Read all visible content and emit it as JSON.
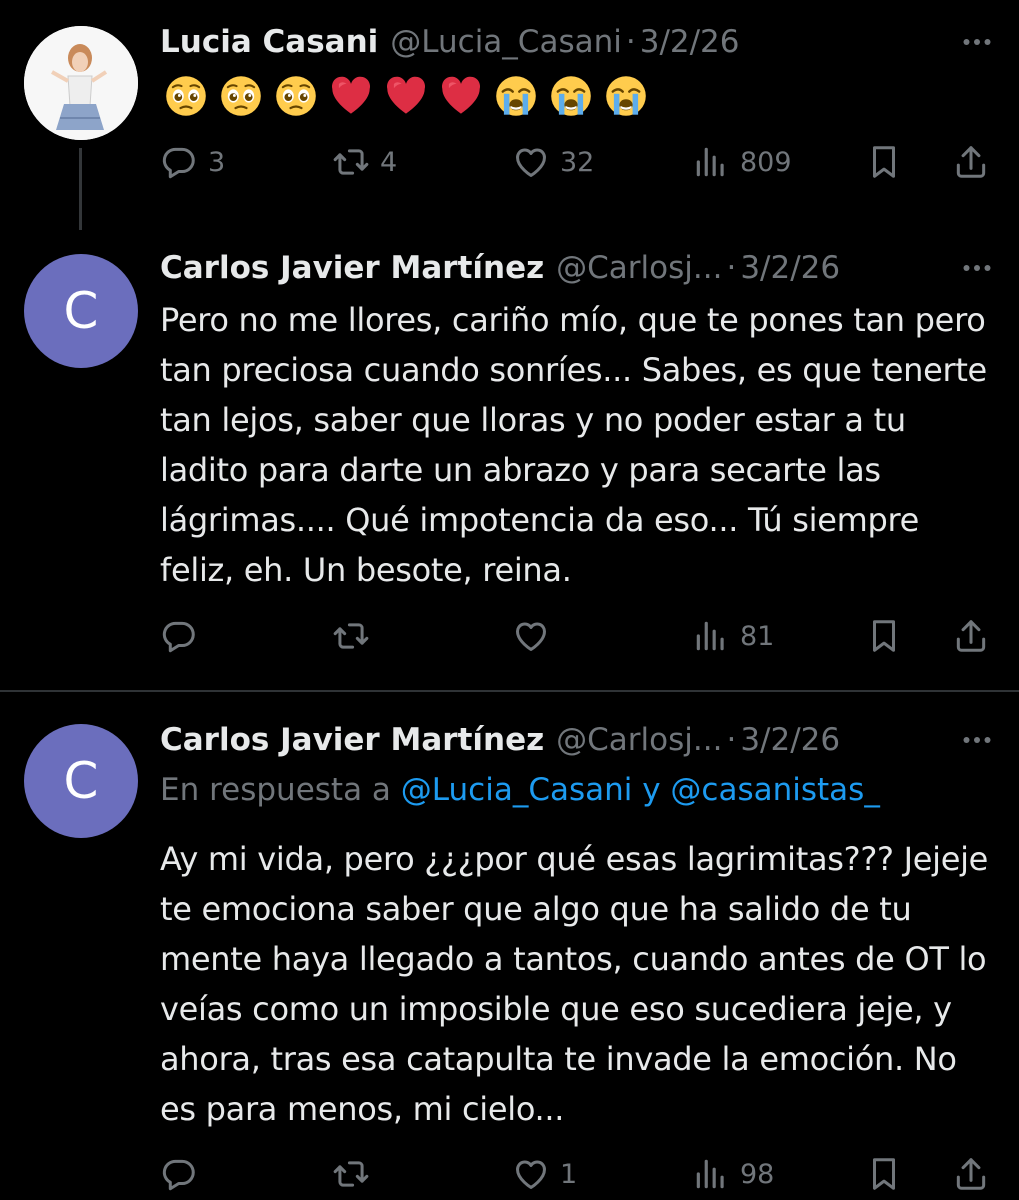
{
  "tweets": [
    {
      "name": "Lucia Casani",
      "handle": "@Lucia_Casani",
      "dot": "·",
      "date": "3/2/26",
      "text": "",
      "emojis": [
        "pleading-face",
        "pleading-face",
        "pleading-face",
        "red-heart",
        "red-heart",
        "red-heart",
        "loudly-crying-face",
        "loudly-crying-face",
        "loudly-crying-face"
      ],
      "replies": "3",
      "reposts": "4",
      "likes": "32",
      "views": "809"
    },
    {
      "avatar_letter": "C",
      "name": "Carlos Javier Martínez",
      "handle": "@Carlosj...",
      "dot": "·",
      "date": "3/2/26",
      "text": "Pero no me llores, cariño mío, que te pones tan pero tan preciosa cuando sonríes... Sabes, es que tenerte tan lejos, saber que lloras y no poder estar a tu ladito para darte un abrazo y para secarte las lágrimas.... Qué impotencia da eso... Tú siempre feliz, eh. Un besote, reina.",
      "replies": "",
      "reposts": "",
      "likes": "",
      "views": "81"
    },
    {
      "avatar_letter": "C",
      "name": "Carlos Javier Martínez",
      "handle": "@Carlosj...",
      "dot": "·",
      "date": "3/2/26",
      "reply_prefix": "En respuesta a",
      "reply_mentions": "@Lucia_Casani y @casanistas_",
      "text": "Ay mi vida, pero ¿¿¿por qué esas lagrimitas??? Jejeje te emociona saber que algo que ha salido de tu mente haya llegado a tantos, cuando antes de OT lo veías como un imposible que eso sucediera jeje, y ahora, tras esa catapulta te invade la emoción. No es para menos, mi cielo...",
      "replies": "",
      "reposts": "",
      "likes": "1",
      "views": "98"
    }
  ],
  "colors": {
    "background": "#000000",
    "text": "#e7e9ea",
    "muted": "#71767b",
    "link": "#1d9bf0",
    "avatar_bg": "#6b6ebd"
  }
}
